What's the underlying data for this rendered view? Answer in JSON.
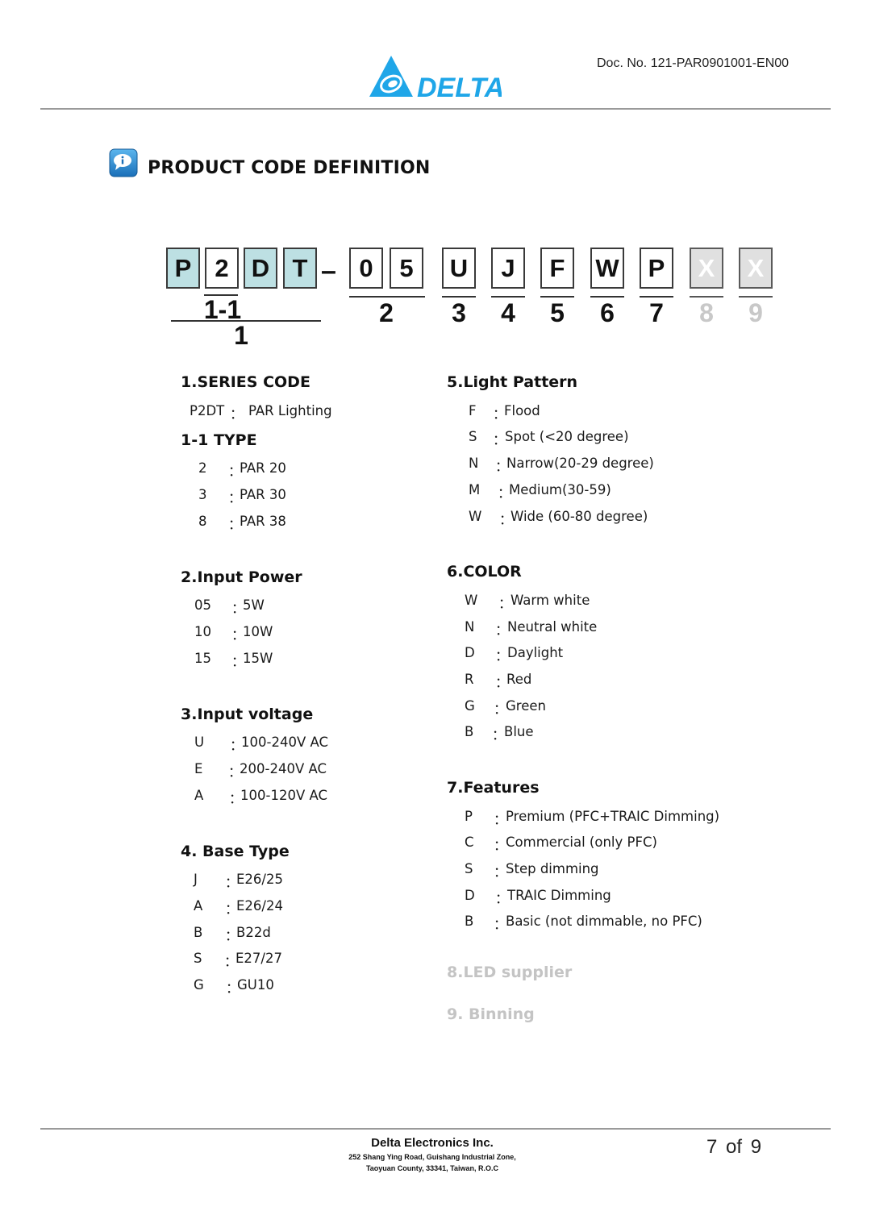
{
  "header": {
    "logo_text": "DELTA",
    "logo_color": "#1fa6e8",
    "doc_no": "Doc. No. 121-PAR0901001-EN00"
  },
  "title": {
    "icon": "info-chat-icon",
    "text": "PRODUCT CODE DEFINITION"
  },
  "code": {
    "chars": [
      {
        "char": "P",
        "style": "teal"
      },
      {
        "char": "2",
        "style": "white"
      },
      {
        "char": "D",
        "style": "teal"
      },
      {
        "char": "T",
        "style": "teal"
      },
      {
        "char": "0",
        "style": "white"
      },
      {
        "char": "5",
        "style": "white"
      },
      {
        "char": "U",
        "style": "white"
      },
      {
        "char": "J",
        "style": "white"
      },
      {
        "char": "F",
        "style": "white"
      },
      {
        "char": "W",
        "style": "white"
      },
      {
        "char": "P",
        "style": "white"
      },
      {
        "char": "X",
        "style": "grey"
      },
      {
        "char": "X",
        "style": "grey"
      }
    ],
    "separator": "–",
    "positions": [
      "1-1",
      "1",
      "2",
      "3",
      "4",
      "5",
      "6",
      "7",
      "8",
      "9"
    ],
    "teal_color": "#bde0e3",
    "grey_color": "#e0e0e0"
  },
  "sections": {
    "series": {
      "title": "1.SERIES CODE",
      "items": [
        {
          "code": "P2DT",
          "desc": "PAR Lighting"
        }
      ]
    },
    "type": {
      "title": "1-1 TYPE",
      "items": [
        {
          "code": "2",
          "desc": "PAR 20"
        },
        {
          "code": "3",
          "desc": "PAR 30"
        },
        {
          "code": "8",
          "desc": "PAR 38"
        }
      ]
    },
    "input_power": {
      "title": "2.Input Power",
      "items": [
        {
          "code": "05",
          "desc": "5W"
        },
        {
          "code": "10",
          "desc": "10W"
        },
        {
          "code": "15",
          "desc": "15W"
        }
      ]
    },
    "input_voltage": {
      "title": "3.Input voltage",
      "items": [
        {
          "code": "U",
          "desc": "100-240V AC"
        },
        {
          "code": "E",
          "desc": "200-240V AC"
        },
        {
          "code": "A",
          "desc": "100-120V AC"
        }
      ]
    },
    "base_type": {
      "title": "4. Base Type",
      "items": [
        {
          "code": "J",
          "desc": "E26/25"
        },
        {
          "code": "A",
          "desc": "E26/24"
        },
        {
          "code": "B",
          "desc": "B22d"
        },
        {
          "code": "S",
          "desc": "E27/27"
        },
        {
          "code": "G",
          "desc": "GU10"
        }
      ]
    },
    "light_pattern": {
      "title": "5.Light Pattern",
      "items": [
        {
          "code": "F",
          "desc": "Flood"
        },
        {
          "code": "S",
          "desc": "Spot (<20 degree)"
        },
        {
          "code": "N",
          "desc": "Narrow(20-29 degree)"
        },
        {
          "code": "M",
          "desc": "Medium(30-59)"
        },
        {
          "code": "W",
          "desc": "Wide (60-80 degree)"
        }
      ]
    },
    "color": {
      "title": "6.COLOR",
      "items": [
        {
          "code": "W",
          "desc": "Warm white"
        },
        {
          "code": "N",
          "desc": "Neutral white"
        },
        {
          "code": "D",
          "desc": "Daylight"
        },
        {
          "code": "R",
          "desc": "Red"
        },
        {
          "code": "G",
          "desc": "Green"
        },
        {
          "code": "B",
          "desc": "Blue"
        }
      ]
    },
    "features": {
      "title": "7.Features",
      "items": [
        {
          "code": "P",
          "desc": "Premium (PFC+TRAIC Dimming)"
        },
        {
          "code": "C",
          "desc": "Commercial (only PFC)"
        },
        {
          "code": "S",
          "desc": "Step dimming"
        },
        {
          "code": "D",
          "desc": "TRAIC Dimming"
        },
        {
          "code": "B",
          "desc": "Basic (not dimmable, no PFC)"
        }
      ]
    },
    "led_supplier": {
      "title": "8.LED supplier"
    },
    "binning": {
      "title": "9. Binning"
    }
  },
  "colon": "：",
  "footer": {
    "company": "Delta Electronics Inc.",
    "address_line1": "252 Shang Ying Road, Guishang Industrial Zone,",
    "address_line2": "Taoyuan County, 33341, Taiwan, R.O.C",
    "page": "7  of  9"
  }
}
